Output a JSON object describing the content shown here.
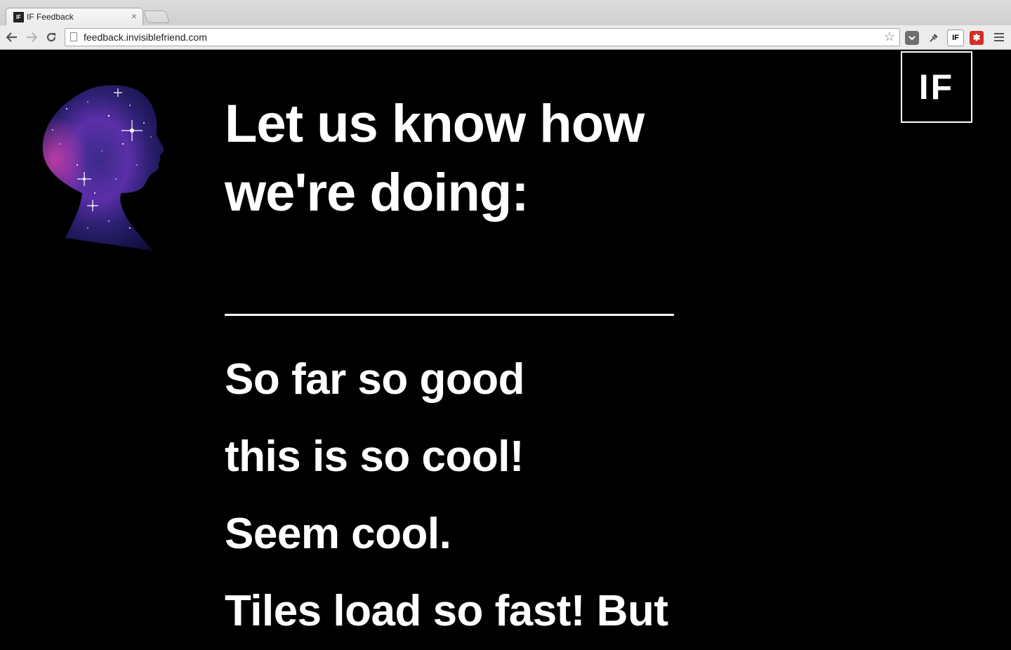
{
  "browser": {
    "tab_title": "IF Feedback",
    "tab_close": "×",
    "tab_favicon": "IF",
    "url": "feedback.invisiblefriend.com",
    "extensions": {
      "if_label": "IF",
      "lastpass_label": "✱"
    }
  },
  "page": {
    "logo_text": "IF",
    "heading": "Let us know how we're doing:",
    "input_value": "",
    "responses": [
      "So far so good",
      "this is so cool!",
      "Seem cool.",
      "Tiles load so fast! But"
    ]
  },
  "colors": {
    "background": "#000000",
    "text": "#ffffff",
    "galaxy_purple": "#5b2fa8",
    "galaxy_pink": "#c13da6"
  },
  "icons": [
    "back-arrow-icon",
    "forward-arrow-icon",
    "reload-icon",
    "page-icon",
    "star-icon",
    "pocket-icon",
    "plug-icon",
    "if-extension-icon",
    "lastpass-icon",
    "menu-icon",
    "galaxy-head-silhouette"
  ]
}
